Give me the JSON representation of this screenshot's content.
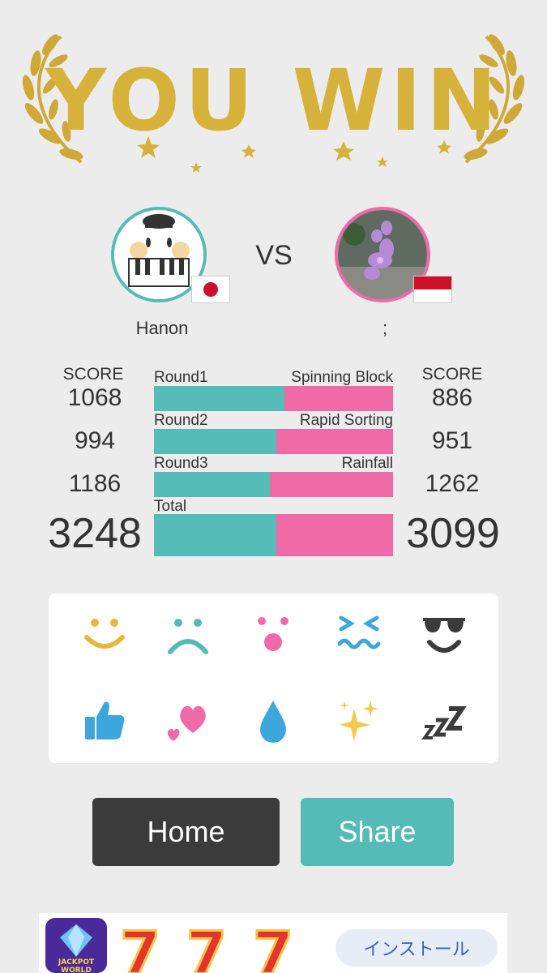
{
  "header": {
    "title": "YOU WIN",
    "title_color": "#d7b23a"
  },
  "players": {
    "left": {
      "name": "Hanon",
      "flag": "japan-flag",
      "ring_color": "#55bbb7"
    },
    "right": {
      "name": ";",
      "flag": "indonesia-flag",
      "ring_color": "#ef6aa6"
    },
    "vs": "VS"
  },
  "scores": {
    "header_left": "SCORE",
    "header_right": "SCORE",
    "rounds": [
      {
        "label": "Round1",
        "game": "Spinning Block",
        "left": "1068",
        "right": "886",
        "left_share": 0.547
      },
      {
        "label": "Round2",
        "game": "Rapid Sorting",
        "left": "994",
        "right": "951",
        "left_share": 0.511
      },
      {
        "label": "Round3",
        "game": "Rainfall",
        "left": "1186",
        "right": "1262",
        "left_share": 0.484
      }
    ],
    "total": {
      "label": "Total",
      "left": "3248",
      "right": "3099",
      "left_share": 0.512
    }
  },
  "reactions": [
    "smile-emoji",
    "sad-emoji",
    "surprised-emoji",
    "wincing-emoji",
    "sunglasses-emoji",
    "thumbs-up-emoji",
    "hearts-emoji",
    "drop-emoji",
    "sparkles-emoji",
    "sleep-emoji"
  ],
  "buttons": {
    "home": "Home",
    "share": "Share"
  },
  "ad": {
    "install": "インストール",
    "logo_text": "JACKPOT WORLD"
  },
  "colors": {
    "teal": "#55bbb7",
    "pink": "#ef6aa6",
    "dark": "#3b3b3b",
    "gold": "#d7b23a"
  }
}
